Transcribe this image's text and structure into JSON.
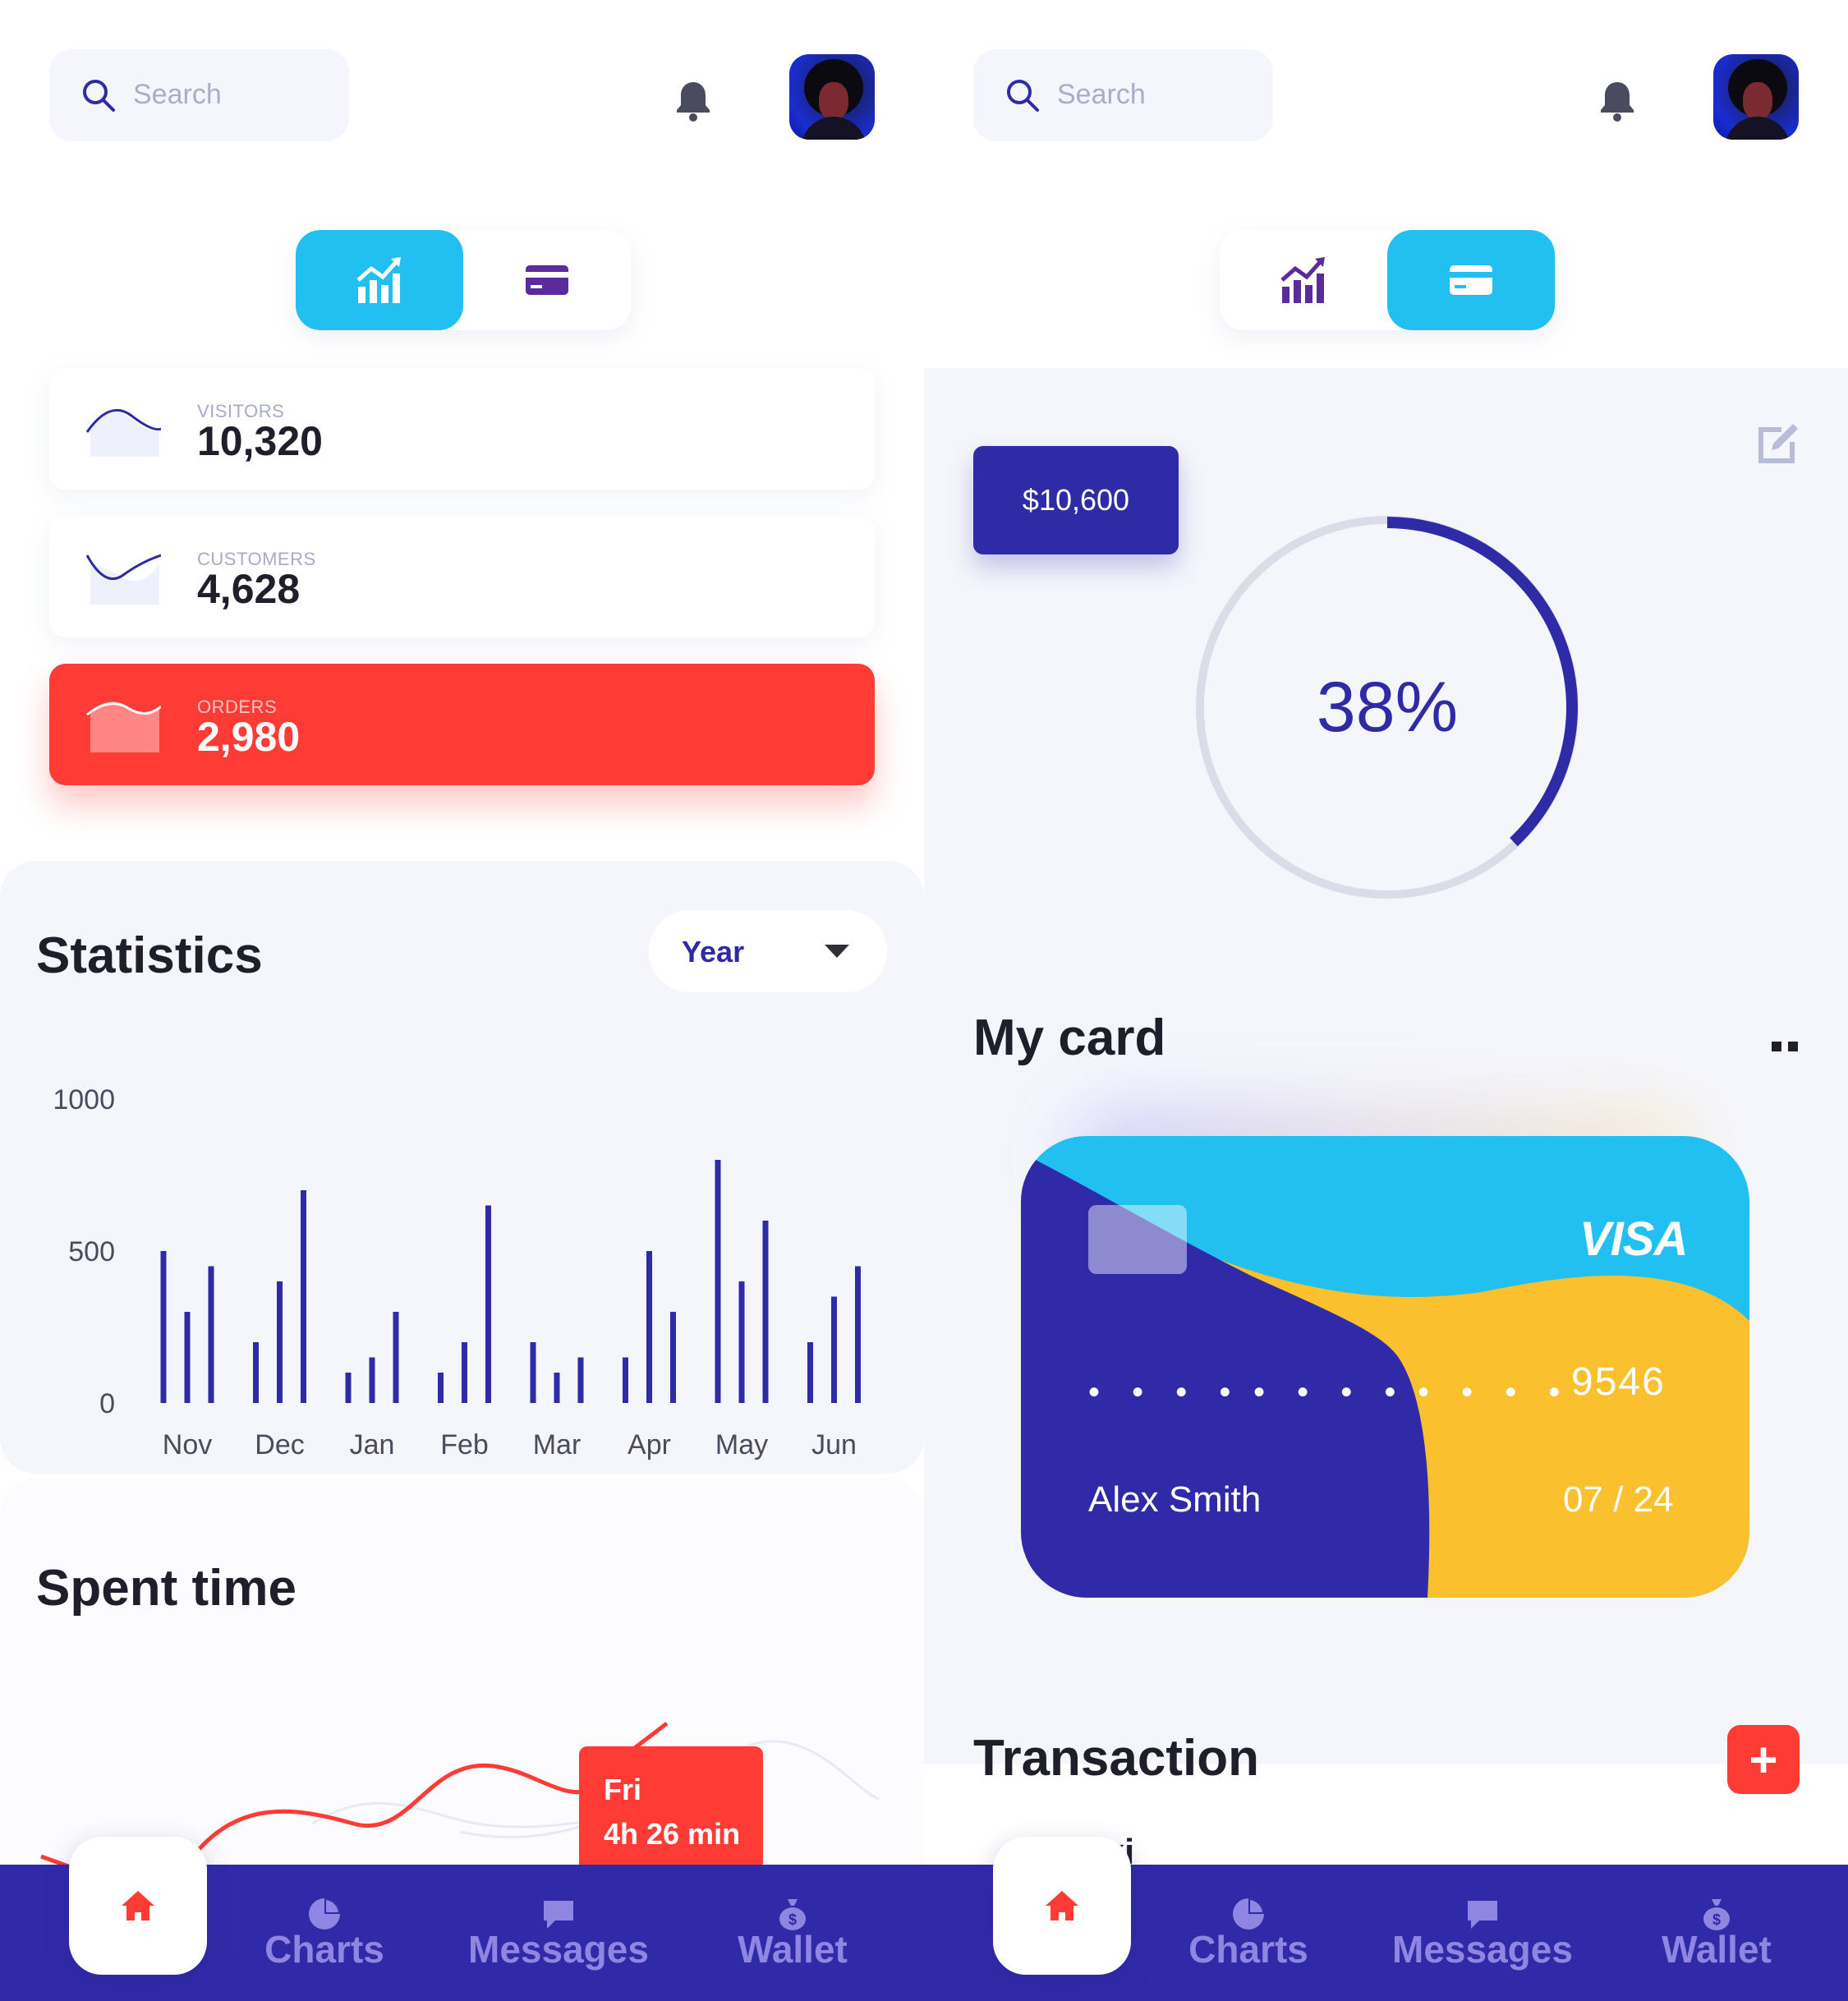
{
  "search": {
    "placeholder": "Search"
  },
  "left": {
    "stats": [
      {
        "label": "VISITORS",
        "value": "10,320"
      },
      {
        "label": "CUSTOMERS",
        "value": "4,628"
      },
      {
        "label": "ORDERS",
        "value": "2,980"
      }
    ],
    "statistics": {
      "title": "Statistics",
      "period": "Year"
    },
    "spent_time": {
      "title": "Spent time",
      "tooltip_day": "Fri",
      "tooltip_value": "4h 26 min"
    }
  },
  "right": {
    "balance": "$10,600",
    "progress_label": "38%",
    "progress": 0.38,
    "my_card": {
      "title": "My card",
      "brand": "VISA",
      "masked_groups": [
        "• • • •",
        "• • • •",
        "• • • •"
      ],
      "last4": "9546",
      "holder": "Alex Smith",
      "expiry": "07 / 24"
    },
    "transaction": {
      "title": "Transaction",
      "add_label": "+",
      "first_item_partial": "axi"
    }
  },
  "nav": {
    "items": [
      "Charts",
      "Messages",
      "Wallet"
    ]
  },
  "colors": {
    "primary": "#2f2aa6",
    "accent": "#22c0f0",
    "danger": "#ff3b35",
    "card_yellow": "#fbc02d",
    "panel_bg": "#f5f6fc"
  },
  "chart_data": {
    "type": "bar",
    "categories": [
      "Nov",
      "Dec",
      "Jan",
      "Feb",
      "Mar",
      "Apr",
      "May",
      "Jun"
    ],
    "yticks": [
      0,
      500,
      1000
    ],
    "ylim": [
      0,
      1000
    ],
    "series": [
      {
        "values": [
          500,
          200,
          100,
          100,
          200,
          150,
          800,
          200
        ]
      },
      {
        "values": [
          300,
          400,
          150,
          200,
          100,
          500,
          400,
          350
        ]
      },
      {
        "values": [
          450,
          700,
          300,
          650,
          150,
          300,
          600,
          450
        ]
      }
    ]
  }
}
